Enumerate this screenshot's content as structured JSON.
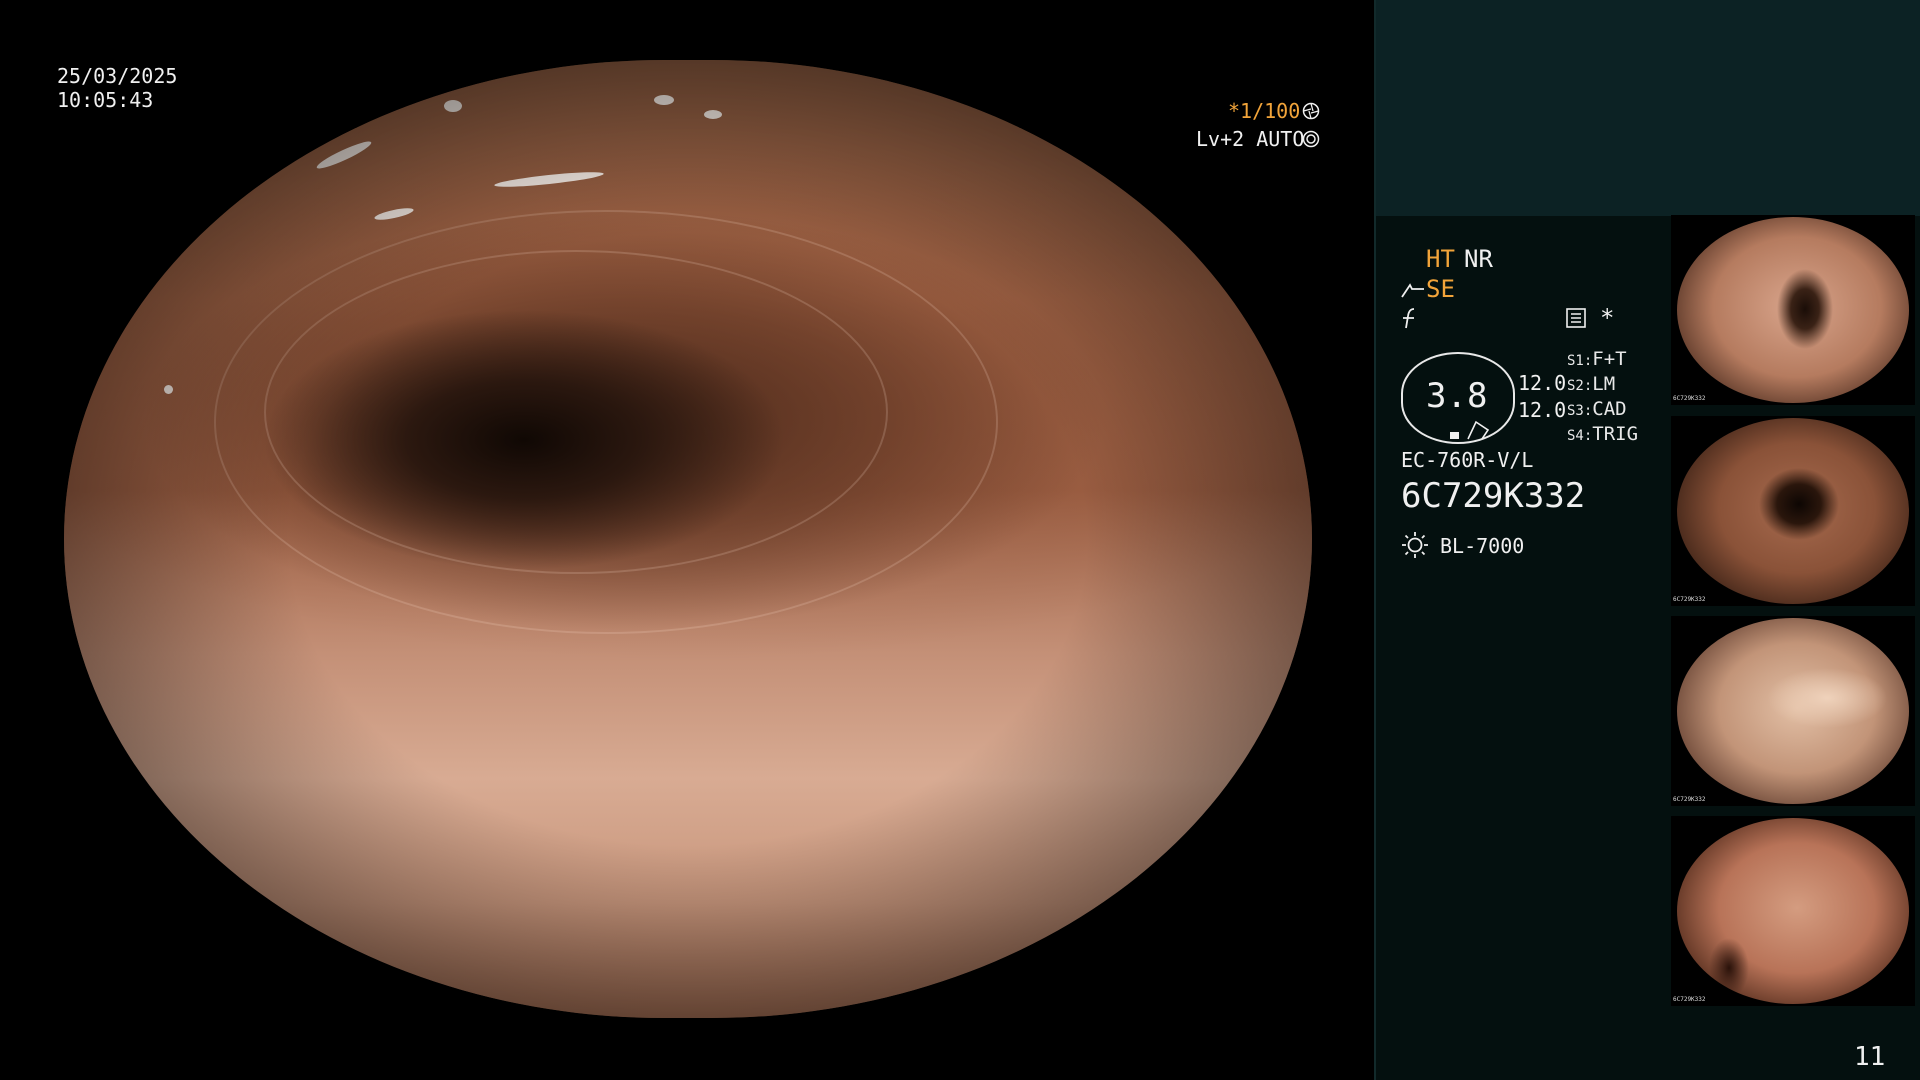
{
  "datetime": {
    "date": "25/03/2025",
    "time": "10:05:43"
  },
  "exposure": {
    "shutter": "*1/100",
    "level": "Lv+2 AUTO"
  },
  "enhance": {
    "ht": "HT",
    "nr": "NR",
    "se": "SE"
  },
  "gauge": {
    "value": "3.8",
    "upper": "12.0",
    "lower": "12.0"
  },
  "switches": [
    {
      "key": "S1",
      "value": "F+T"
    },
    {
      "key": "S2",
      "value": "LM"
    },
    {
      "key": "S3",
      "value": "CAD"
    },
    {
      "key": "S4",
      "value": "TRIG"
    }
  ],
  "scope": {
    "model": "EC-760R-V/L",
    "serial": "6C729K332"
  },
  "light_source": {
    "name": "BL-7000"
  },
  "asterisk": "*",
  "image_count": "11",
  "thumbnails": [
    {
      "serial": "6C729K332"
    },
    {
      "serial": "6C729K332"
    },
    {
      "serial": "6C729K332"
    },
    {
      "serial": "6C729K332"
    }
  ],
  "colors": {
    "accent": "#f2a43a",
    "panel_top": "#0c2224",
    "panel_bg": "#04100f"
  },
  "icons": [
    "aperture-icon",
    "target-icon",
    "knife-icon",
    "strike-icon",
    "settings-icon",
    "lamp-icon",
    "scope-tip-icon"
  ]
}
